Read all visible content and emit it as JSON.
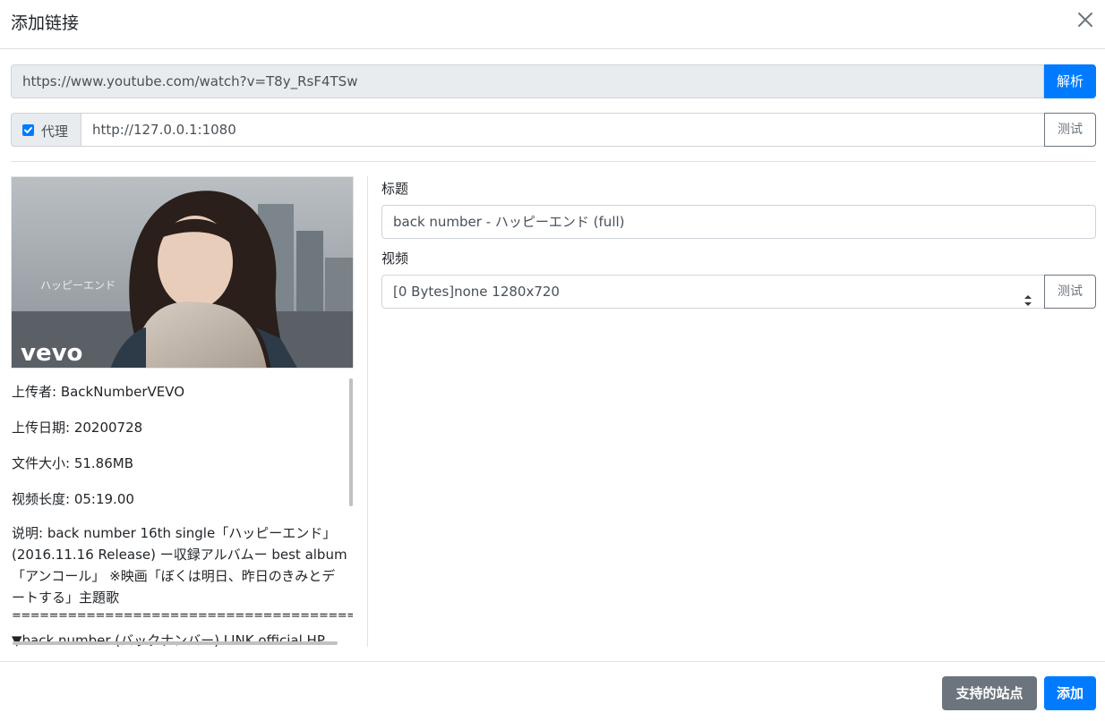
{
  "dialog": {
    "title": "添加链接",
    "close_icon": "close-icon"
  },
  "url": {
    "value": "https://www.youtube.com/watch?v=T8y_RsF4TSw",
    "parse_label": "解析"
  },
  "proxy": {
    "checked": true,
    "label": "代理",
    "value": "http://127.0.0.1:1080",
    "test_label": "测试"
  },
  "thumbnail": {
    "overlay_text": "ハッピーエンド",
    "logo_text": "vevo"
  },
  "info": {
    "uploader": "上传者: BackNumberVEVO",
    "upload_date": "上传日期: 20200728",
    "file_size": "文件大小: 51.86MB",
    "duration": "视频长度: 05:19.00",
    "description": "说明: back number 16th single「ハッピーエンド」(2016.11.16 Release) ー収録アルバムー best album「アンコール」 ※映画「ぼくは明日、昨日のきみとデートする」主題歌",
    "separator": "==========================================",
    "link_line": "▼back number (バックナンバー) LINK official HP"
  },
  "form": {
    "title_label": "标题",
    "title_value": "back number - ハッピーエンド (full)",
    "video_label": "视频",
    "video_value": "[0 Bytes]none 1280x720",
    "video_test_label": "测试"
  },
  "footer": {
    "sites_label": "支持的站点",
    "add_label": "添加"
  },
  "colors": {
    "primary": "#007bff",
    "secondary": "#6c757d",
    "border": "#ced4da"
  }
}
